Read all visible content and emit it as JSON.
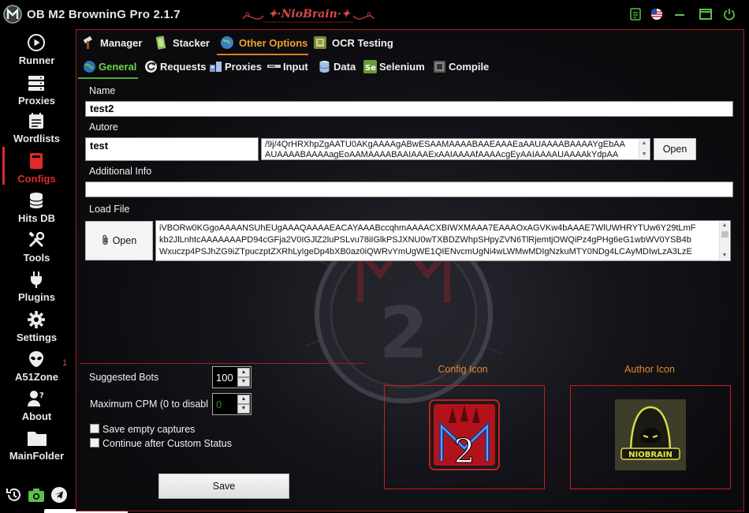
{
  "app": {
    "title": "OB M2 BrowninG Pro  2.1.7",
    "brand": "NioBrain"
  },
  "sidebar": {
    "items": [
      {
        "label": "Runner"
      },
      {
        "label": "Proxies"
      },
      {
        "label": "Wordlists"
      },
      {
        "label": "Configs"
      },
      {
        "label": "Hits DB"
      },
      {
        "label": "Tools"
      },
      {
        "label": "Plugins"
      },
      {
        "label": "Settings"
      },
      {
        "label": "A51Zone"
      },
      {
        "label": "About"
      },
      {
        "label": "MainFolder"
      }
    ],
    "a51_badge": "1",
    "active": "Configs"
  },
  "tabs_main": [
    {
      "label": "Manager"
    },
    {
      "label": "Stacker"
    },
    {
      "label": "Other Options"
    },
    {
      "label": "OCR Testing"
    }
  ],
  "tabs_sub": [
    {
      "label": "General"
    },
    {
      "label": "Requests"
    },
    {
      "label": "Proxies"
    },
    {
      "label": "Input"
    },
    {
      "label": "Data"
    },
    {
      "label": "Selenium"
    },
    {
      "label": "Compile"
    }
  ],
  "form": {
    "name_label": "Name",
    "name_value": "test2",
    "autore_label": "Autore",
    "autore_value": "test",
    "autore_image_line1": "/9j/4QrHRXhpZgAATU0AKgAAAAgABwESAAMAAAABAAEAAAEaAAUAAAABAAAAYgEbAA",
    "autore_image_line2": "AUAAAABAAAAagEoAAMAAAABAAIAAAExAAIAAAAfAAAAcgEyAAIAAAAUAAAAkYdpAA",
    "open_label": "Open",
    "additional_label": "Additional Info",
    "additional_value": "",
    "loadfile_label": "Load File",
    "loadfile_open": "Open",
    "loadfile_lines": [
      "iVBORw0KGgoAAAANSUhEUgAAAQAAAAEACAYAAABccqhmAAAACXBIWXMAAA7EAAAOxAGVKw4bAAAE7WlUWHRYTUw6Y29tLmF",
      "kb2JlLnhtcAAAAAAAPD94cGFja2V0IGJlZ2luPSLvu78iIGlkPSJXNU0wTXBDZWhpSHpyZVN6TlRjemtjOWQiPz4gPHg6eG1wbWV0YSB4b",
      "Wxuczp4PSJhZG9iZTpuczptZXRhLyIgeDp4bXB0az0iQWRvYmUgWE1QIENvcmUgNi4wLWMwMDIgNzkuMTY0NDg4LCAyMDIwLzA3LzE"
    ],
    "suggested_bots_label": "Suggested Bots",
    "suggested_bots_value": "100",
    "max_cpm_label": "Maximum CPM (0 to disabl",
    "max_cpm_value": "0",
    "save_empty_label": "Save empty captures",
    "continue_label": "Continue after Custom Status",
    "save_label": "Save",
    "config_icon_label": "Config Icon",
    "author_icon_label": "Author Icon",
    "author_icon_text": "NIOBRAIN",
    "config_icon_text": "2"
  },
  "colors": {
    "accent_red": "#e02a2a",
    "frame_red": "#c41f1f",
    "tab_orange": "#f0a32b",
    "tab_green": "#6fd34a",
    "icon_title_orange": "#e8882a"
  }
}
